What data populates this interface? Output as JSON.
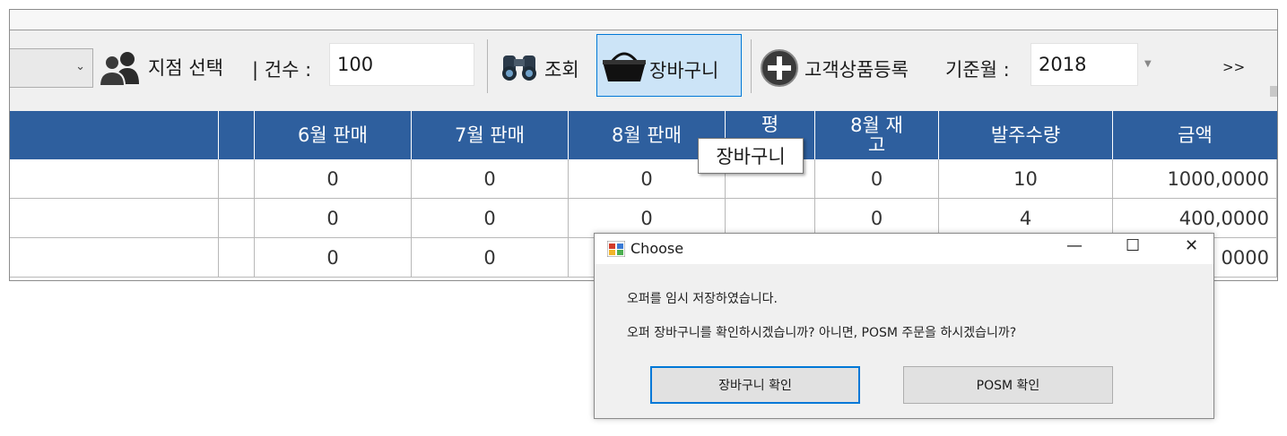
{
  "toolbar": {
    "branch_select_label": "지점 선택",
    "count_label": "| 건수 :",
    "count_value": "100",
    "search_label": "조회",
    "basket_label": "장바구니",
    "register_label": "고객상품등록",
    "base_month_label": "기준월 :",
    "base_month_value": "2018",
    "more_label": ">>"
  },
  "grid": {
    "headers": [
      "6월 판매",
      "7월 판매",
      "8월 판매",
      "평",
      "8월 재\n고",
      "발주수량",
      "금액"
    ],
    "rows": [
      {
        "m6": "0",
        "m7": "0",
        "m8": "0",
        "stock": "0",
        "order_qty": "10",
        "amount": "1000,0000"
      },
      {
        "m6": "0",
        "m7": "0",
        "m8": "0",
        "stock": "0",
        "order_qty": "4",
        "amount": "400,0000"
      },
      {
        "m6": "0",
        "m7": "0",
        "m8": "",
        "stock": "",
        "order_qty": "",
        "amount": "0000"
      }
    ]
  },
  "tooltip": {
    "text": "장바구니"
  },
  "dialog": {
    "title": "Choose",
    "minimize": "—",
    "maximize": "☐",
    "close": "✕",
    "message1": "오퍼를 임시 저장하였습니다.",
    "message2": "오퍼 장바구니를 확인하시겠습니까? 아니면, POSM 주문을 하시겠습니까?",
    "btn_basket": "장바구니 확인",
    "btn_posm": "POSM 확인"
  }
}
